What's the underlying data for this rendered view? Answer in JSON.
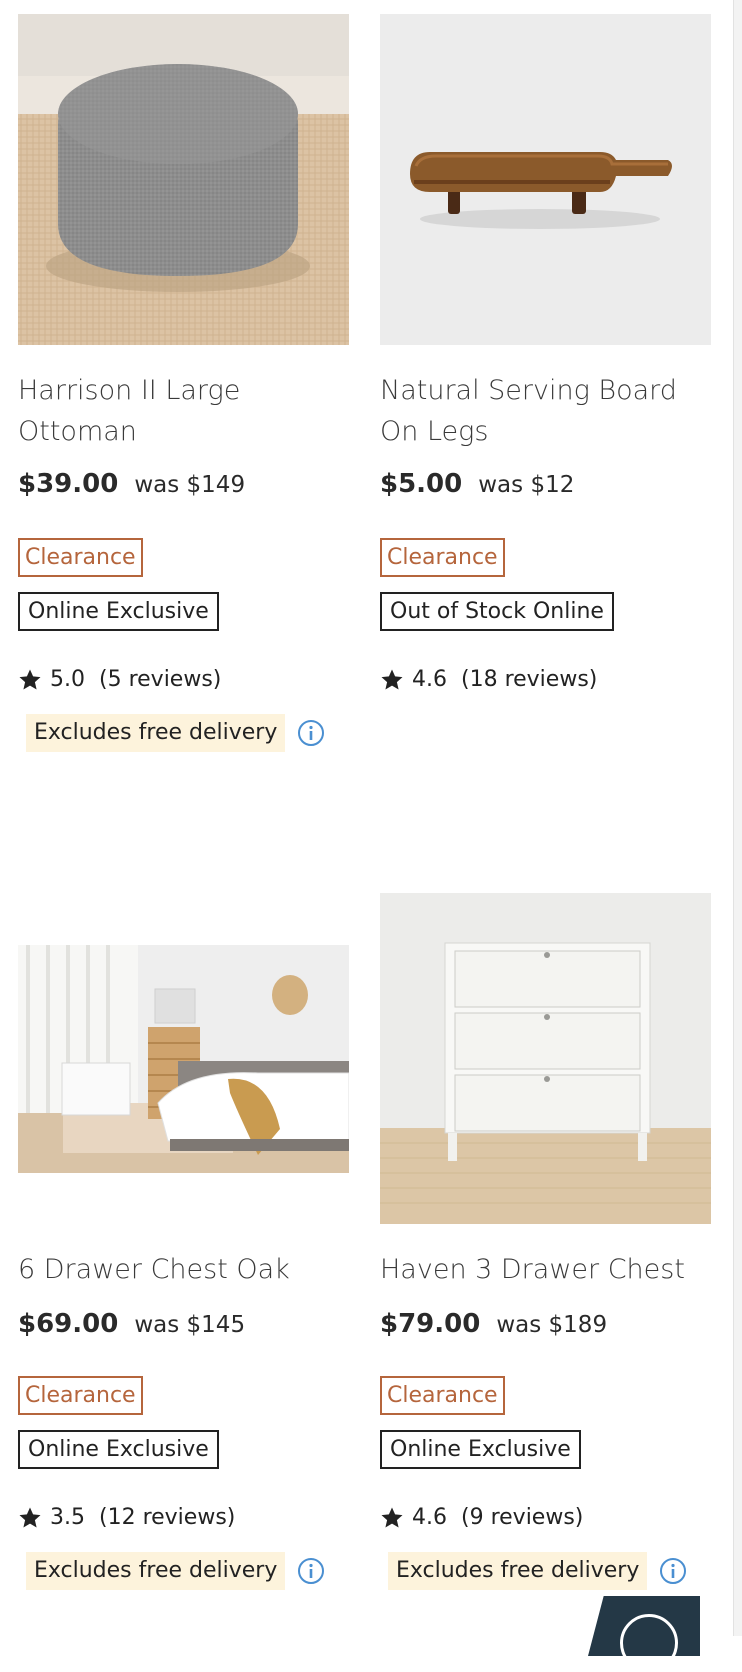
{
  "products": [
    {
      "name": "Harrison II Large Ottoman",
      "price": "$39.00",
      "was": "was $149",
      "badges": [
        "Clearance",
        "Online Exclusive"
      ],
      "rating": "5.0",
      "reviews": "(5 reviews)",
      "delivery_note": "Excludes free delivery"
    },
    {
      "name": "Natural Serving Board On Legs",
      "price": "$5.00",
      "was": "was $12",
      "badges": [
        "Clearance",
        "Out of Stock Online"
      ],
      "rating": "4.6",
      "reviews": "(18 reviews)"
    },
    {
      "name": "6 Drawer Chest Oak",
      "price": "$69.00",
      "was": "was $145",
      "badges": [
        "Clearance",
        "Online Exclusive"
      ],
      "rating": "3.5",
      "reviews": "(12 reviews)",
      "delivery_note": "Excludes free delivery"
    },
    {
      "name": "Haven 3 Drawer Chest",
      "price": "$79.00",
      "was": "was $189",
      "badges": [
        "Clearance",
        "Online Exclusive"
      ],
      "rating": "4.6",
      "reviews": "(9 reviews)",
      "delivery_note": "Excludes free delivery"
    }
  ],
  "icons": {
    "rating": "star-icon",
    "delivery_info": "info-icon",
    "chat": "chat-icon"
  },
  "colors": {
    "clearance": "#b5653c",
    "delivery_highlight": "#fdf3dc",
    "info_icon": "#4a8fd1",
    "chat_button": "#243846"
  }
}
